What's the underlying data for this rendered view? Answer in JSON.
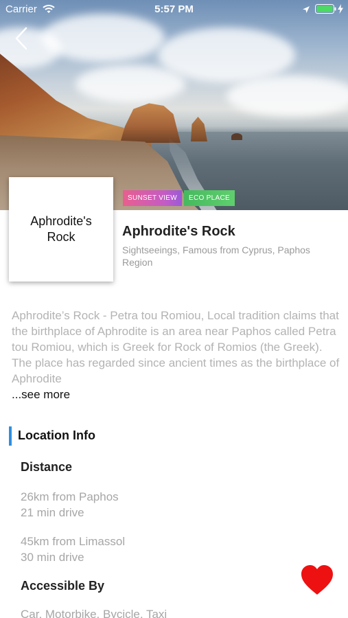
{
  "status_bar": {
    "carrier": "Carrier",
    "time": "5:57 PM",
    "icons": [
      "wifi-icon",
      "location-arrow-icon",
      "battery-icon",
      "charging-icon"
    ],
    "battery_color": "#4cd964"
  },
  "navigation": {
    "back_icon": "chevron-left-icon"
  },
  "tags": [
    {
      "label": "SUNSET VIEW",
      "color": "#d85ca8"
    },
    {
      "label": "ECO PLACE",
      "color": "#52c463"
    }
  ],
  "place": {
    "thumbnail_text": "Aphrodite's Rock",
    "title": "Aphrodite's Rock",
    "categories": "Sightseeings, Famous from Cyprus, Paphos Region"
  },
  "description": {
    "text": "Aphrodite’s Rock - Petra tou Romiou, Local tradition claims that the birthplace of Aphrodite is an area near Paphos called Petra tou Romiou, which is Greek for Rock of Romios (the Greek). The place has regarded since ancient times as the birthplace of Aphrodite",
    "see_more": "...see more"
  },
  "location_info": {
    "heading": "Location Info",
    "accent_color": "#2d8fe0",
    "distance_heading": "Distance",
    "distances": [
      {
        "line1": "26km from Paphos",
        "line2": "21 min drive"
      },
      {
        "line1": "45km from Limassol",
        "line2": "30 min drive"
      }
    ],
    "accessible_heading": "Accessible By",
    "accessible_value": "Car, Motorbike, Bycicle, Taxi"
  },
  "favorite": {
    "icon": "heart-icon",
    "color": "#ee1111"
  }
}
